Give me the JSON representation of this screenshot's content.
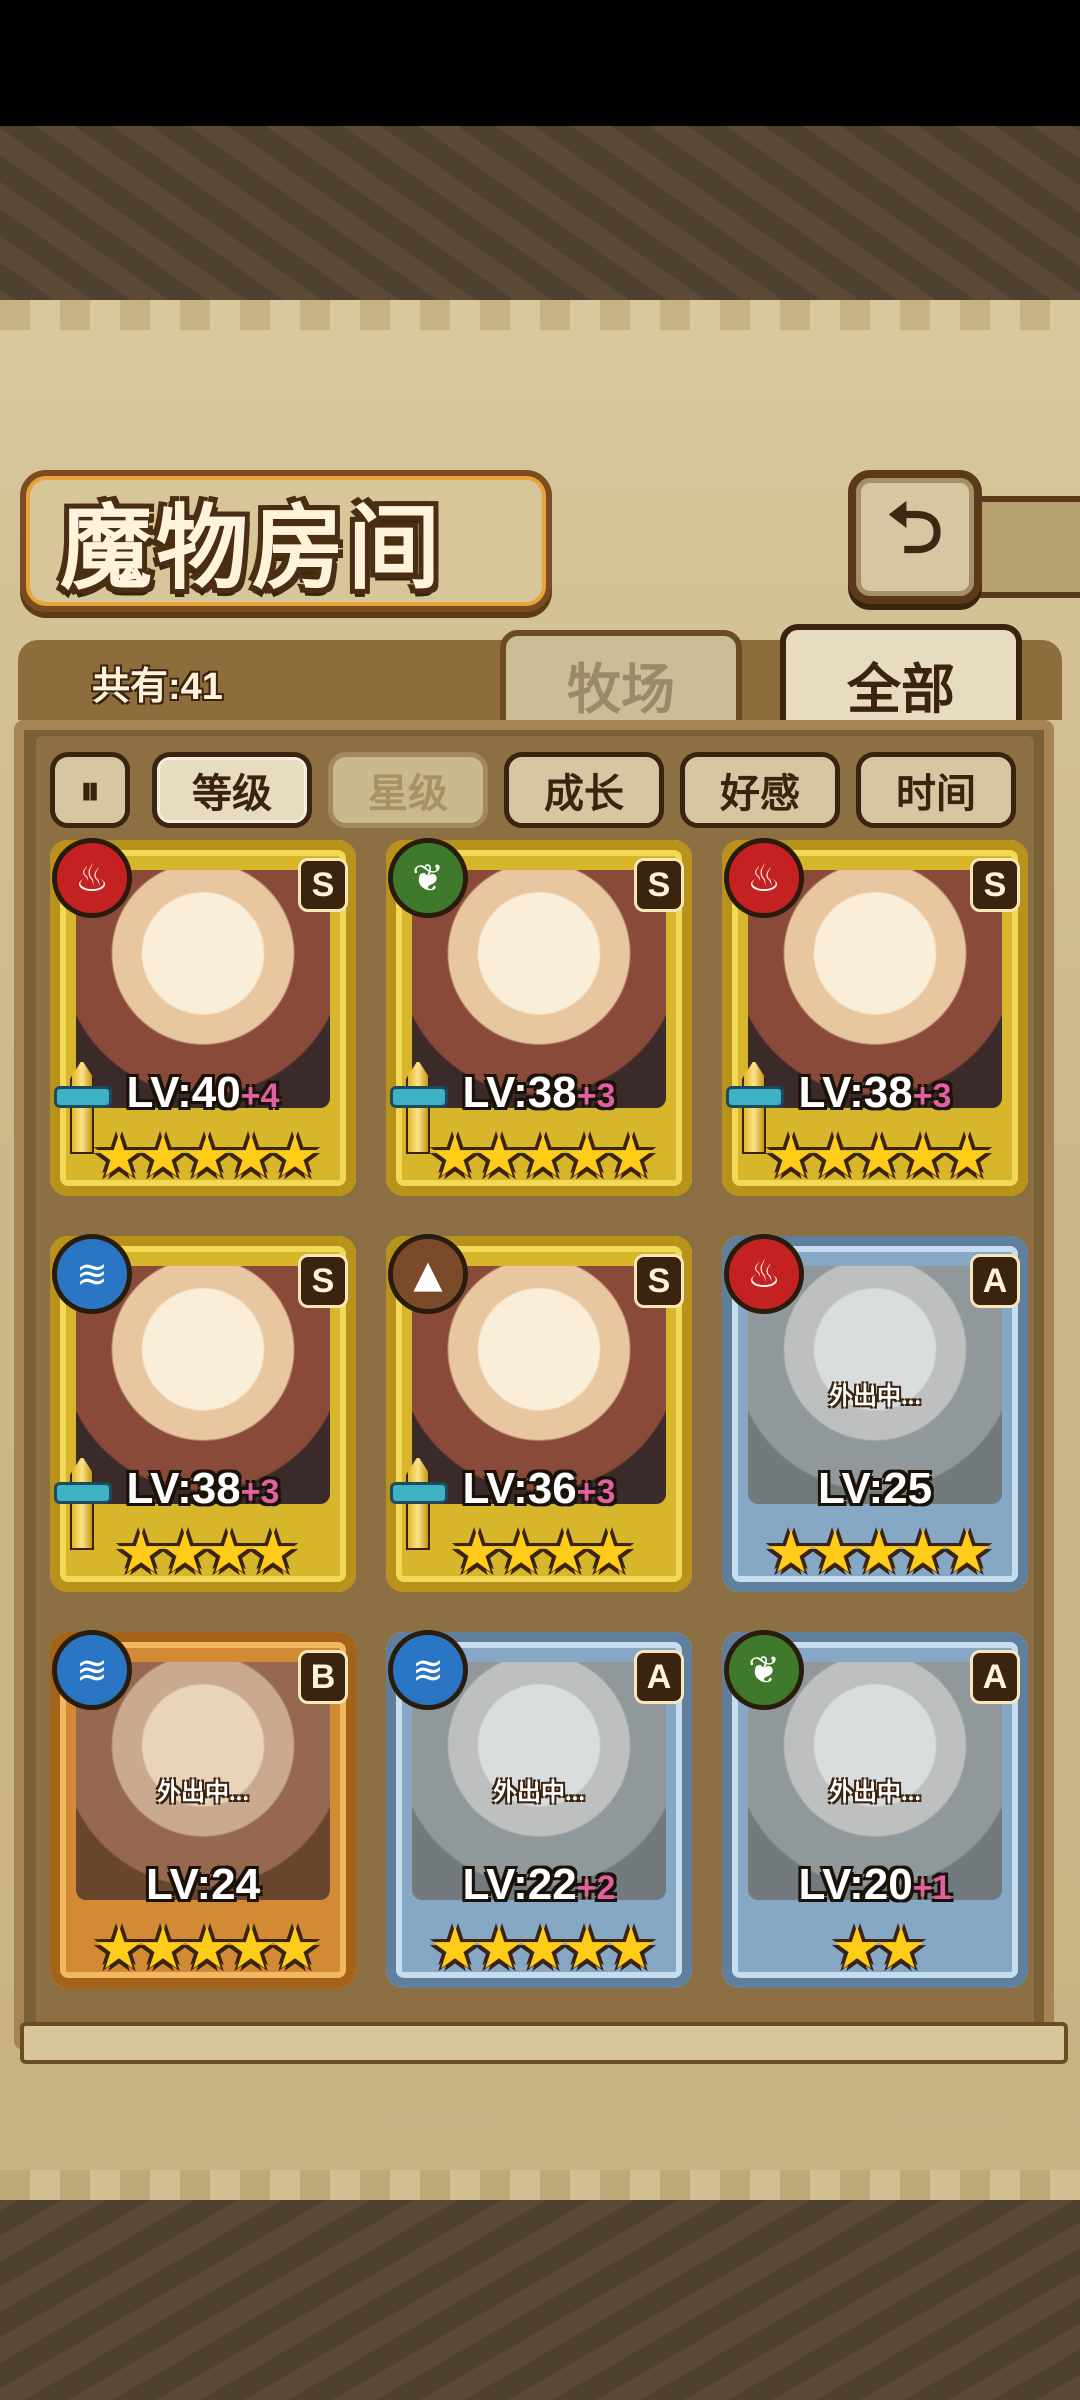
{
  "screen": {
    "title": "魔物房间",
    "back_icon": "⮌",
    "total_label": "共有:41"
  },
  "tabs": [
    {
      "label": "牧场",
      "active": false
    },
    {
      "label": "全部",
      "active": true
    }
  ],
  "sort": {
    "toggle_icon": "⏸",
    "buttons": [
      {
        "label": "等级",
        "state": "active"
      },
      {
        "label": "星级",
        "state": "dim"
      },
      {
        "label": "成长",
        "state": "normal"
      },
      {
        "label": "好感",
        "state": "normal"
      },
      {
        "label": "时间",
        "state": "normal"
      }
    ]
  },
  "monsters": [
    {
      "element": "fire",
      "rank": "S",
      "frame": "gold",
      "level": "LV:40",
      "plus": "+4",
      "stars": "★★★★★",
      "status": "",
      "weapon": true
    },
    {
      "element": "leaf",
      "rank": "S",
      "frame": "gold",
      "level": "LV:38",
      "plus": "+3",
      "stars": "★★★★★",
      "status": "",
      "weapon": true
    },
    {
      "element": "fire",
      "rank": "S",
      "frame": "gold",
      "level": "LV:38",
      "plus": "+3",
      "stars": "★★★★★",
      "status": "",
      "weapon": true
    },
    {
      "element": "water",
      "rank": "S",
      "frame": "gold",
      "level": "LV:38",
      "plus": "+3",
      "stars": "★★★★",
      "status": "",
      "weapon": true
    },
    {
      "element": "earth",
      "rank": "S",
      "frame": "gold",
      "level": "LV:36",
      "plus": "+3",
      "stars": "★★★★",
      "status": "",
      "weapon": true
    },
    {
      "element": "fire",
      "rank": "A",
      "frame": "blue",
      "level": "LV:25",
      "plus": "",
      "stars": "★★★★★",
      "status": "外出中...",
      "weapon": false
    },
    {
      "element": "water",
      "rank": "B",
      "frame": "orange",
      "level": "LV:24",
      "plus": "",
      "stars": "★★★★★",
      "status": "外出中...",
      "weapon": false
    },
    {
      "element": "water",
      "rank": "A",
      "frame": "blue",
      "level": "LV:22",
      "plus": "+2",
      "stars": "★★★★★",
      "status": "外出中...",
      "weapon": false
    },
    {
      "element": "leaf",
      "rank": "A",
      "frame": "blue",
      "level": "LV:20",
      "plus": "+1",
      "stars": "★★",
      "status": "外出中...",
      "weapon": false
    }
  ],
  "element_icons": {
    "fire": "♨",
    "leaf": "❦",
    "water": "≋",
    "earth": "▲"
  }
}
